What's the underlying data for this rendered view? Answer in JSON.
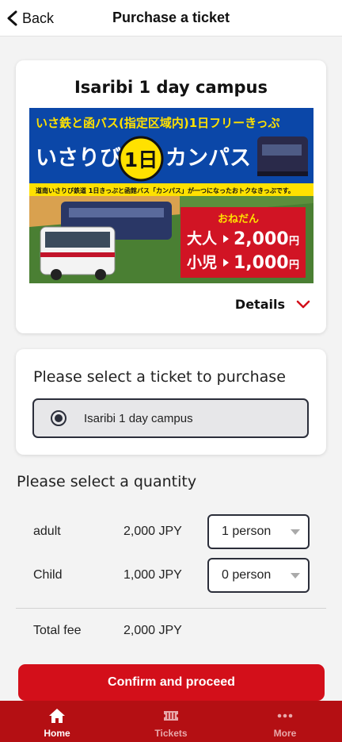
{
  "header": {
    "back_label": "Back",
    "title": "Purchase a ticket"
  },
  "ticket_card": {
    "name": "Isaribi 1 day campus",
    "details_label": "Details",
    "banner": {
      "top_line": "いさ鉄と函バス(指定区域内)1日フリーきっぷ",
      "title_left": "いさりび",
      "title_badge": "1日",
      "title_right": "カンパス",
      "subtitle": "道南いさりび鉄道 1日きっぷと函館バス「カンパス」が一つになったおトクなきっぷです。",
      "price_heading": "おねだん",
      "adult_label": "大人",
      "adult_price": "2,000",
      "child_label": "小児",
      "child_price": "1,000",
      "yen": "円"
    }
  },
  "ticket_select": {
    "heading": "Please select a ticket to purchase",
    "option_label": "Isaribi 1 day campus"
  },
  "quantity": {
    "heading": "Please select a quantity",
    "rows": [
      {
        "label": "adult",
        "price": "2,000 JPY",
        "selected": "1 person"
      },
      {
        "label": "Child",
        "price": "1,000 JPY",
        "selected": "0 person"
      }
    ],
    "total_label": "Total fee",
    "total_value": "2,000 JPY"
  },
  "confirm_label": "Confirm and proceed",
  "nav": {
    "items": [
      {
        "label": "Home",
        "icon": "home-icon",
        "active": true
      },
      {
        "label": "Tickets",
        "icon": "ticket-icon",
        "active": false
      },
      {
        "label": "More",
        "icon": "more-icon",
        "active": false
      }
    ]
  },
  "colors": {
    "accent": "#d30f1a",
    "nav_bg": "#b40f13",
    "page_bg": "#f3f3f3",
    "banner_blue": "#0b47a8"
  }
}
